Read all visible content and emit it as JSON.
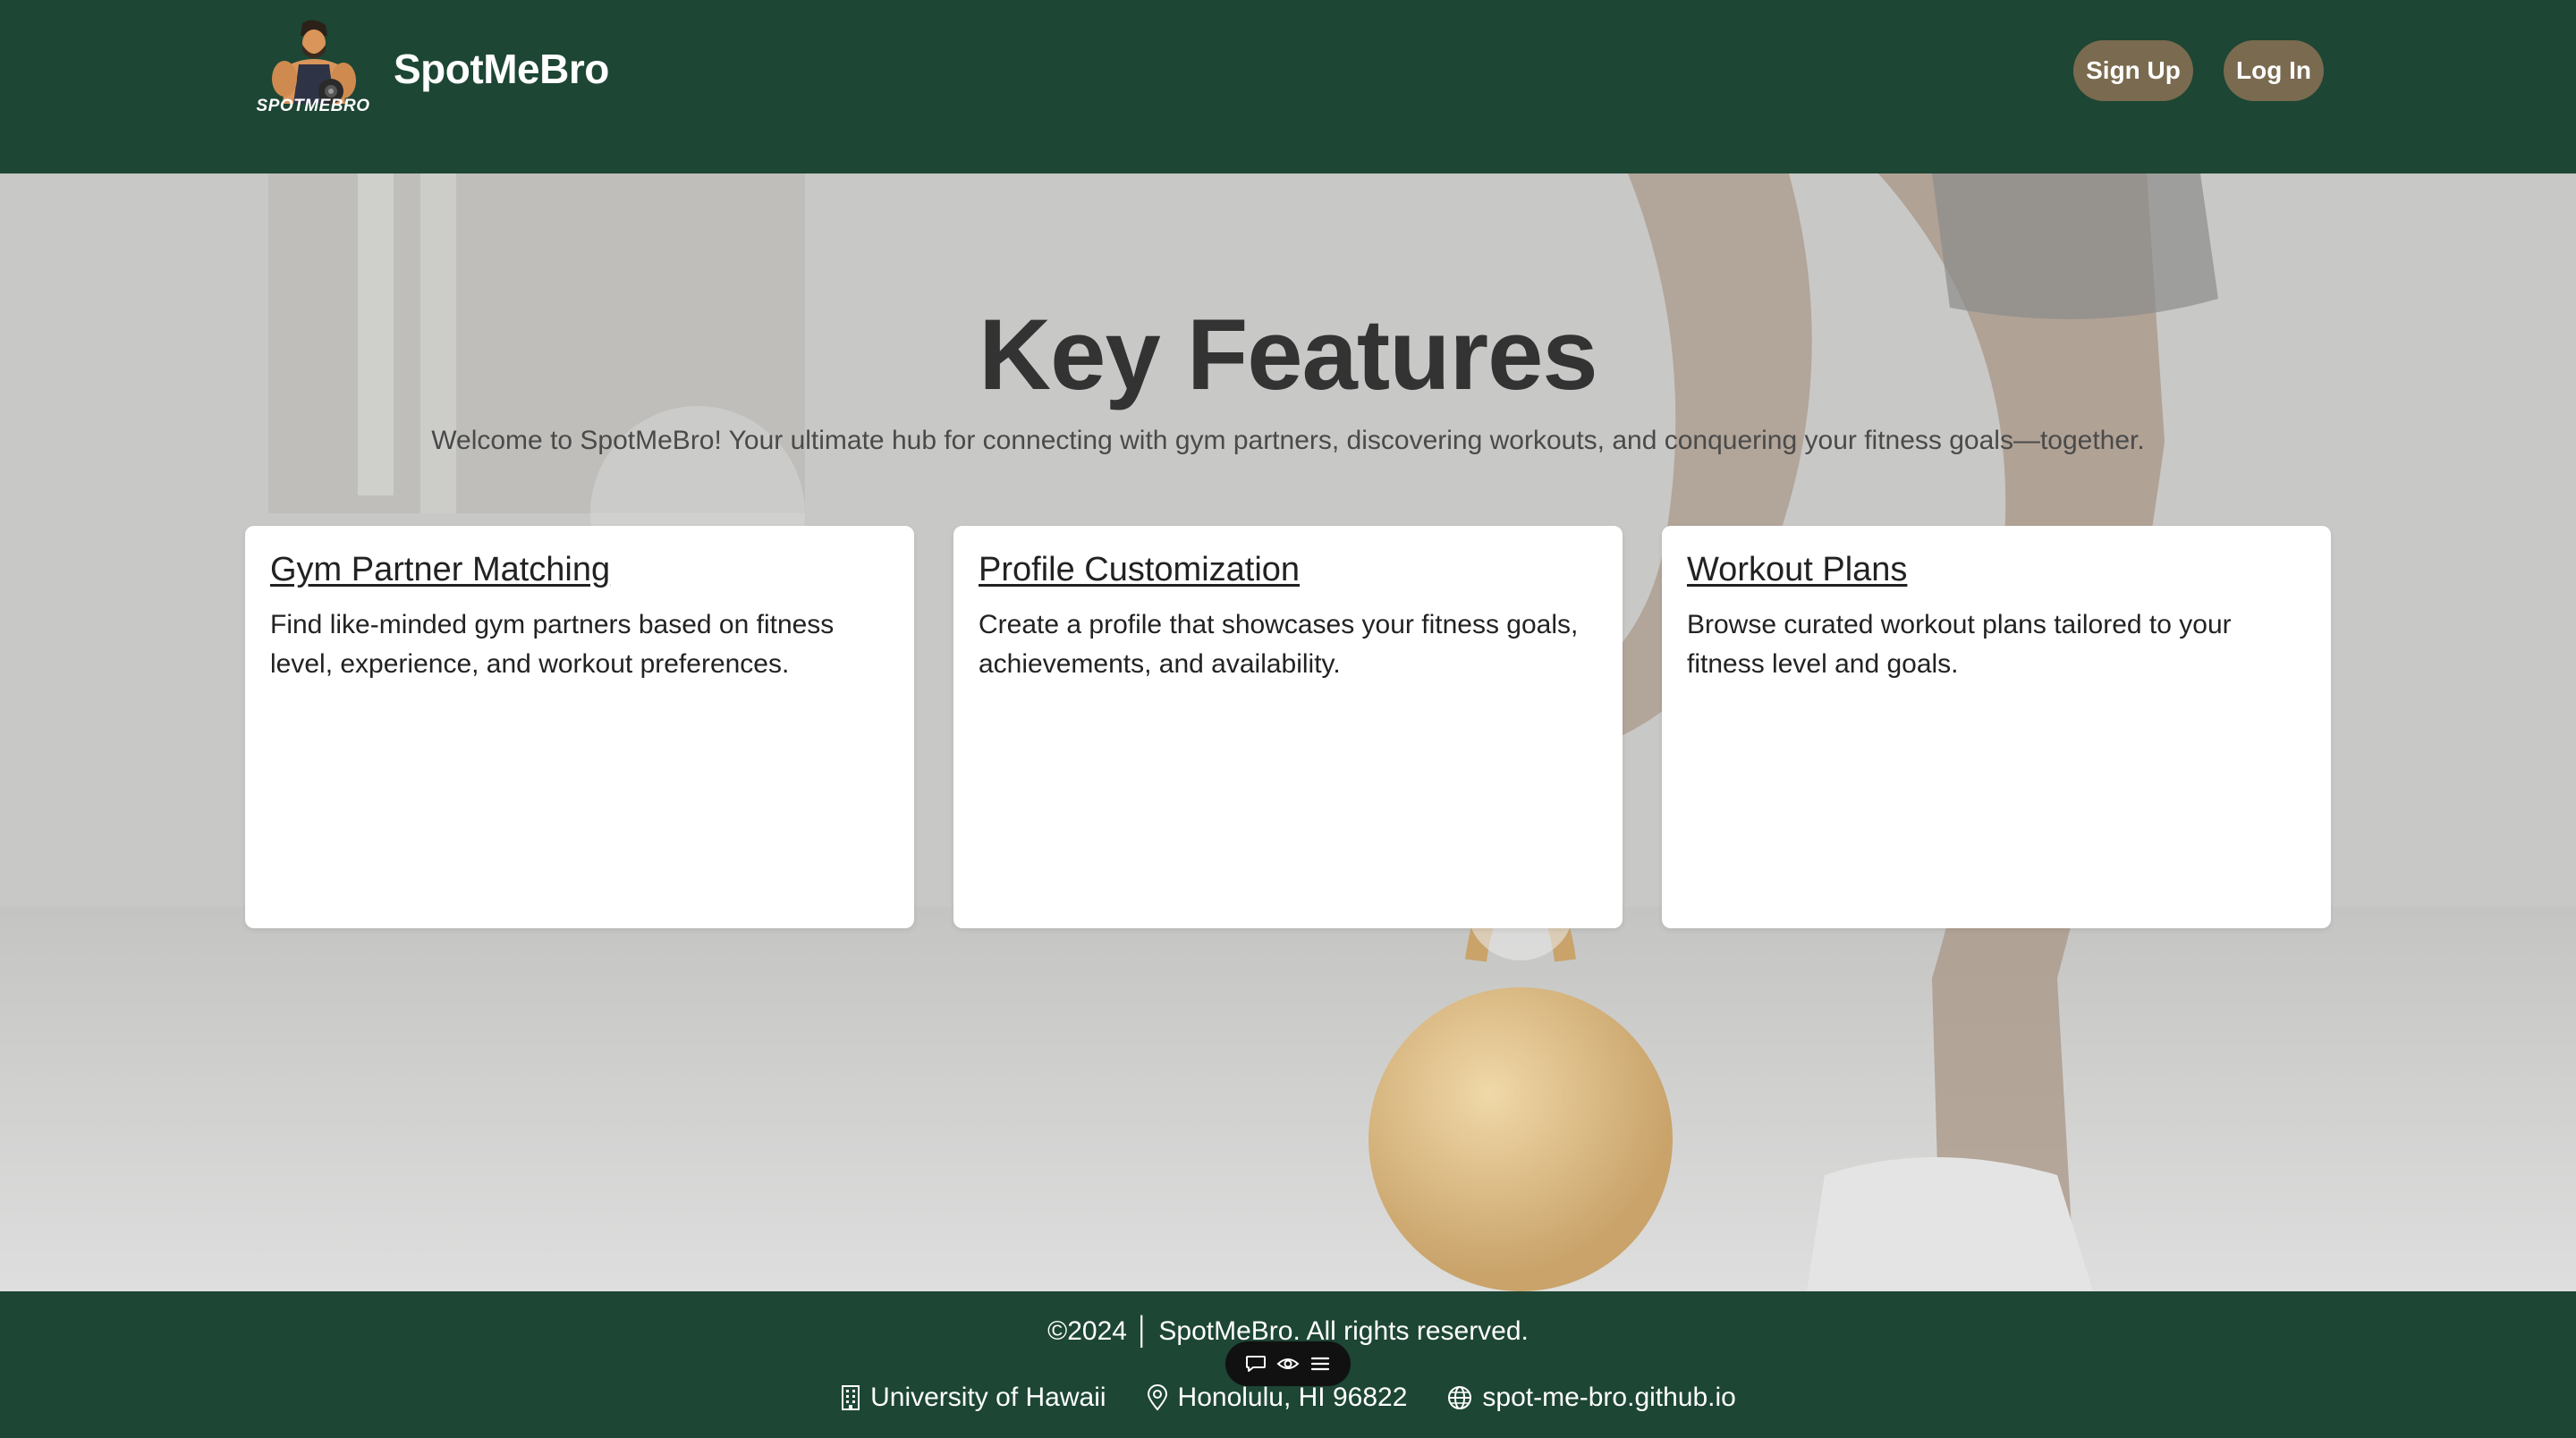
{
  "header": {
    "brand_name": "SpotMeBro",
    "logo_text": "SPOTMEBRO",
    "sign_up_label": "Sign Up",
    "log_in_label": "Log In"
  },
  "hero": {
    "title": "Key Features",
    "subtitle": "Welcome to SpotMeBro! Your ultimate hub for connecting with gym partners, discovering workouts, and conquering your fitness goals—together."
  },
  "features": [
    {
      "title": "Gym Partner Matching",
      "description": "Find like-minded gym partners based on fitness level, experience, and workout preferences."
    },
    {
      "title": "Profile Customization",
      "description": "Create a profile that showcases your fitness goals, achievements, and availability."
    },
    {
      "title": "Workout Plans",
      "description": "Browse curated workout plans tailored to your fitness level and goals."
    }
  ],
  "footer": {
    "copyright": "©2024 │ SpotMeBro. All rights reserved.",
    "university": "University of Hawaii",
    "location": "Honolulu, HI 96822",
    "website": "spot-me-bro.github.io"
  },
  "colors": {
    "header_bg": "#1d4634",
    "button_bg": "#7a6a4f",
    "card_bg": "#ffffff",
    "title_color": "#333333"
  },
  "icons": {
    "building": "building-icon",
    "location": "map-pin-icon",
    "globe": "globe-icon",
    "toolbar": [
      "comment-icon",
      "eye-icon",
      "menu-icon"
    ]
  }
}
